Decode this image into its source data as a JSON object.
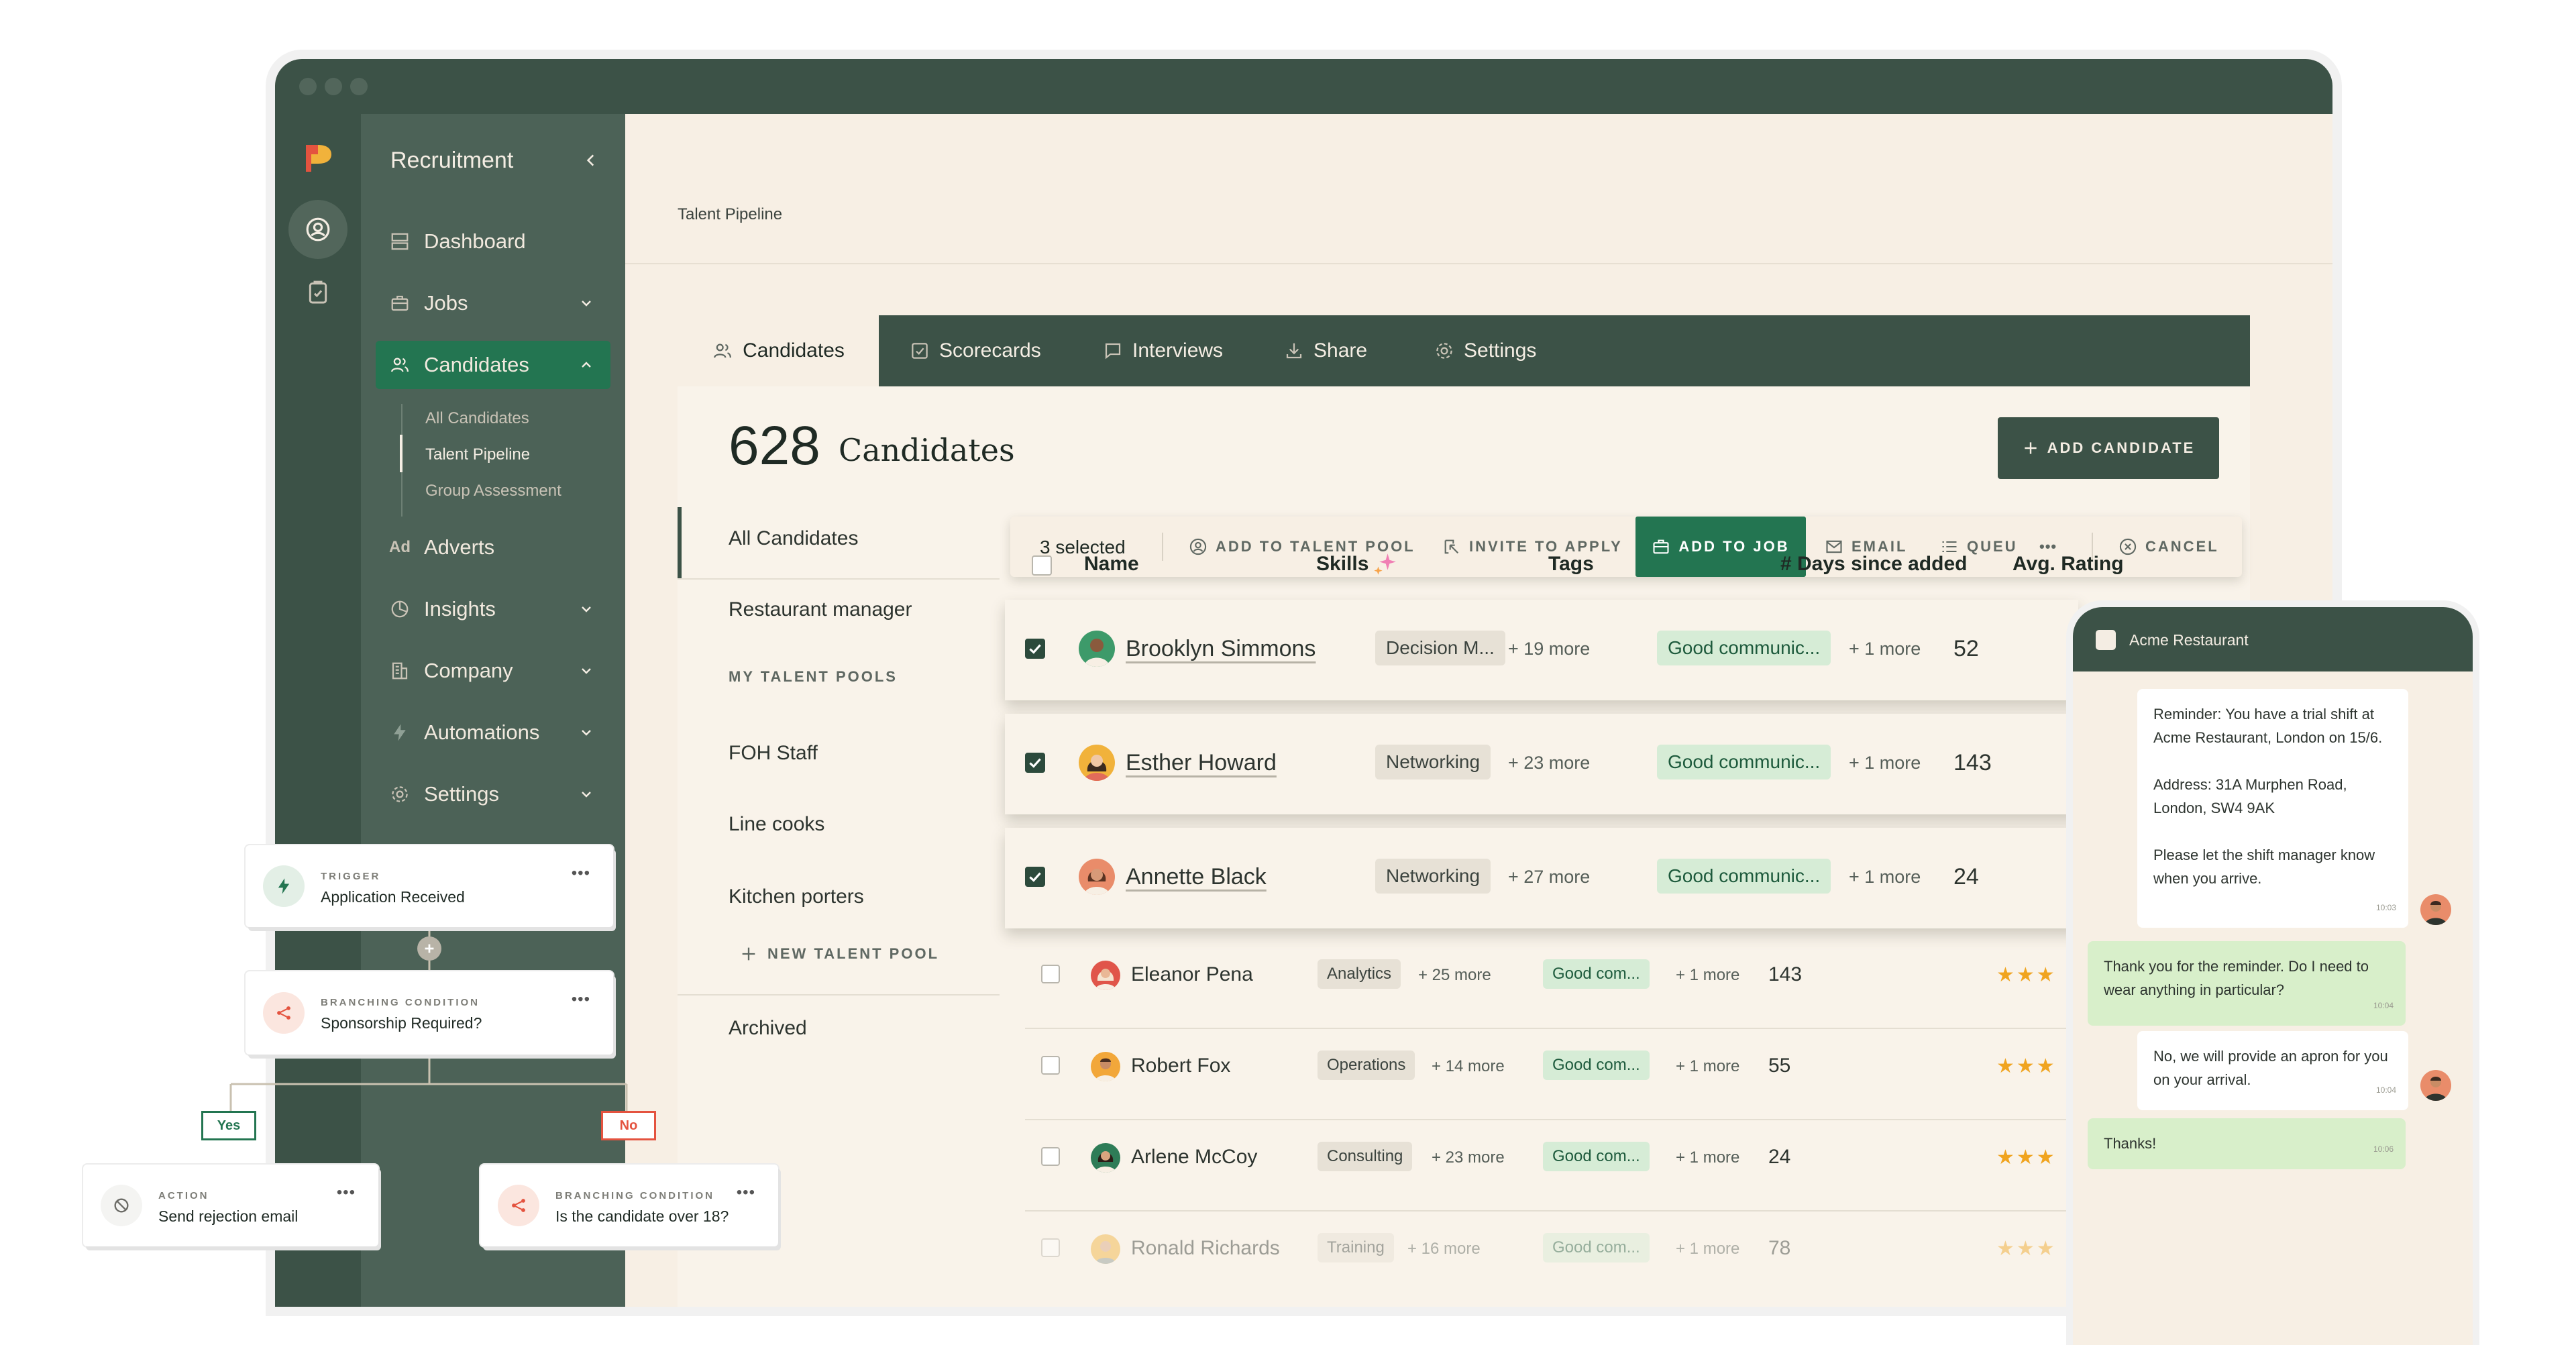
{
  "app": {
    "module_title": "Recruitment",
    "breadcrumb": "Talent Pipeline"
  },
  "sidebar": {
    "items": [
      {
        "label": "Dashboard",
        "icon": "dashboard-icon"
      },
      {
        "label": "Jobs",
        "icon": "briefcase-icon"
      },
      {
        "label": "Candidates",
        "icon": "users-icon",
        "active": true
      },
      {
        "label": "Adverts",
        "icon": "ad-icon",
        "icon_text": "Ad"
      },
      {
        "label": "Insights",
        "icon": "pie-chart-icon"
      },
      {
        "label": "Company",
        "icon": "building-icon"
      },
      {
        "label": "Automations",
        "icon": "lightning-icon"
      },
      {
        "label": "Settings",
        "icon": "gear-icon"
      }
    ],
    "sub_items": [
      "All Candidates",
      "Talent Pipeline",
      "Group Assessment"
    ],
    "active_sub": "Talent Pipeline"
  },
  "tabs": [
    {
      "label": "Candidates",
      "icon": "users-icon"
    },
    {
      "label": "Scorecards",
      "icon": "checkbox-icon"
    },
    {
      "label": "Interviews",
      "icon": "chat-icon"
    },
    {
      "label": "Share",
      "icon": "download-icon"
    },
    {
      "label": "Settings",
      "icon": "gear-icon"
    }
  ],
  "header": {
    "count": "628",
    "title": "Candidates",
    "add_button": "ADD CANDIDATE"
  },
  "left_pane": {
    "all": "All Candidates",
    "restaurant": "Restaurant manager",
    "section": "MY TALENT POOLS",
    "pools": [
      "FOH Staff",
      "Line cooks",
      "Kitchen porters"
    ],
    "new_pool": "NEW TALENT POOL",
    "archived": "Archived"
  },
  "toolbar": {
    "selected": "3 selected",
    "add_to_pool": "ADD TO TALENT POOL",
    "invite": "INVITE TO APPLY",
    "add_to_job": "ADD TO JOB",
    "email": "EMAIL",
    "queue": "QUEU",
    "more": "•••",
    "cancel": "CANCEL"
  },
  "table": {
    "columns": {
      "name": "Name",
      "skills": "Skills",
      "tags": "Tags",
      "days": "# Days since added",
      "rating": "Avg. Rating"
    },
    "selected_rows": [
      {
        "name": "Brooklyn Simmons",
        "skill": "Decision M...",
        "skill_more": "+ 19 more",
        "tag": "Good communic...",
        "tag_more": "+ 1 more",
        "days": "52",
        "avatar_color": "#3d9a6a"
      },
      {
        "name": "Esther Howard",
        "skill": "Networking",
        "skill_more": "+ 23 more",
        "tag": "Good communic...",
        "tag_more": "+ 1 more",
        "days": "143",
        "avatar_color": "#f1b23b"
      },
      {
        "name": "Annette Black",
        "skill": "Networking",
        "skill_more": "+ 27 more",
        "tag": "Good communic...",
        "tag_more": "+ 1 more",
        "days": "24",
        "avatar_color": "#e98c6a"
      }
    ],
    "rows": [
      {
        "name": "Eleanor Pena",
        "skill": "Analytics",
        "skill_more": "+ 25 more",
        "tag": "Good com...",
        "tag_more": "+ 1 more",
        "days": "143",
        "stars": "★★★",
        "avatar_color": "#e0554a"
      },
      {
        "name": "Robert Fox",
        "skill": "Operations",
        "skill_more": "+ 14 more",
        "tag": "Good com...",
        "tag_more": "+ 1 more",
        "days": "55",
        "stars": "★★★",
        "avatar_color": "#f2a73a"
      },
      {
        "name": "Arlene McCoy",
        "skill": "Consulting",
        "skill_more": "+ 23 more",
        "tag": "Good com...",
        "tag_more": "+ 1 more",
        "days": "24",
        "stars": "★★★",
        "avatar_color": "#2e7c57"
      },
      {
        "name": "Ronald Richards",
        "skill": "Training",
        "skill_more": "+ 16 more",
        "tag": "Good com...",
        "tag_more": "+ 1 more",
        "days": "78",
        "stars": "★★★",
        "avatar_color": "#f1b23b",
        "faded": true
      }
    ]
  },
  "automation": {
    "trigger": {
      "kicker": "TRIGGER",
      "title": "Application Received"
    },
    "branch1": {
      "kicker": "BRANCHING CONDITION",
      "title": "Sponsorship Required?"
    },
    "yes": "Yes",
    "no": "No",
    "action": {
      "kicker": "ACTION",
      "title": "Send rejection email"
    },
    "branch2": {
      "kicker": "BRANCHING CONDITION",
      "title": "Is the candidate over 18?"
    },
    "dots": "•••"
  },
  "chat": {
    "title": "Acme Restaurant",
    "messages": [
      {
        "side": "in",
        "text1": "Reminder: You have a trial shift at Acme Restaurant, London on 15/6.",
        "text2": "Address: 31A Murphen Road, London, SW4 9AK",
        "text3": "Please let the shift manager know when you arrive.",
        "time": "10:03"
      },
      {
        "side": "out",
        "text": "Thank you for the reminder. Do I need to wear anything in particular?",
        "time": "10:04"
      },
      {
        "side": "in",
        "text": "No, we will provide an apron for you on your arrival.",
        "time": "10:04"
      },
      {
        "side": "out",
        "text": "Thanks!",
        "time": "10:06"
      }
    ]
  },
  "colors": {
    "dark_green": "#3c5247",
    "sidebar_green": "#4c6257",
    "accent_green": "#237551",
    "cream": "#f7efe4",
    "tag_green": "#d6ecd6",
    "star": "#f0a41f",
    "no_red": "#e4533f"
  }
}
